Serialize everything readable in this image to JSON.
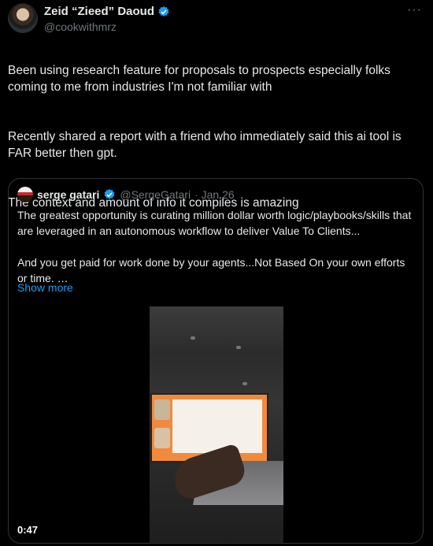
{
  "author": {
    "name": "Zeid “Zieed” Daoud",
    "handle": "@cookwithmrz"
  },
  "tweet": {
    "paragraphs": [
      "Been using research feature for proposals to prospects especially folks coming to me from industries I'm not familiar with",
      "Recently shared a report with a friend who immediately said this ai tool is FAR better then gpt.",
      "The context and amount of info it compiles is amazing"
    ]
  },
  "quote": {
    "name": "serge gatari",
    "handle": "@SergeGatari",
    "date": "· Jan 26",
    "paragraphs": [
      "The greatest opportunity is curating million dollar worth logic/playbooks/skills that are leveraged in an autonomous workflow to deliver Value To Clients...",
      "And you get paid for work done by your agents...Not Based On your own efforts or time. …"
    ],
    "show_more": "Show more",
    "video_duration": "0:47"
  },
  "icons": {
    "verified": "verified-badge-icon",
    "more": "more-icon"
  },
  "colors": {
    "background": "#000000",
    "text": "#e7e9ea",
    "muted": "#71767b",
    "link": "#1d9bf0",
    "border": "#2f3336"
  }
}
